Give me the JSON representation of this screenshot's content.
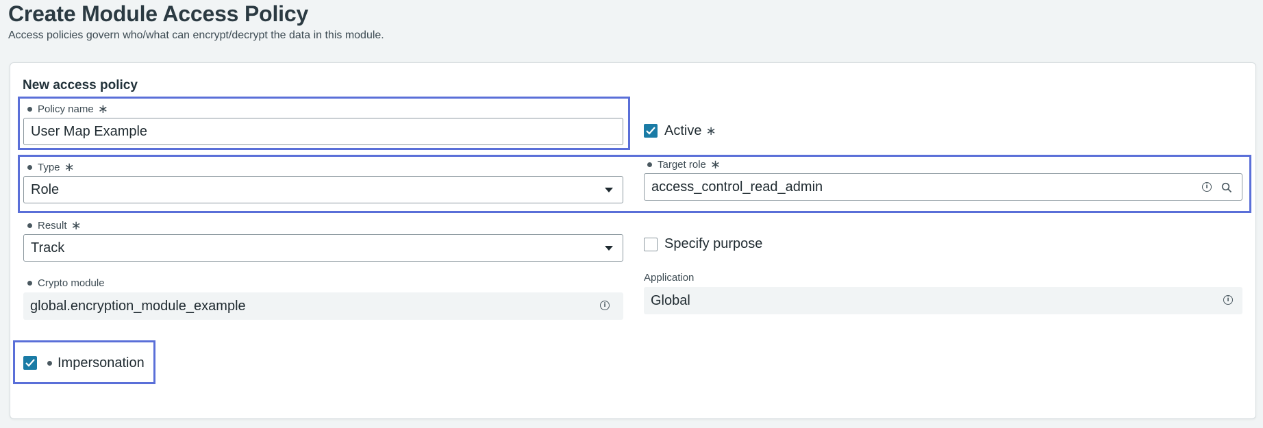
{
  "page": {
    "title": "Create Module Access Policy",
    "subtitle": "Access policies govern who/what can encrypt/decrypt the data in this module."
  },
  "form": {
    "section_title": "New access policy",
    "required_mark": "∗",
    "policy_name": {
      "label": "Policy name",
      "value": "User Map Example"
    },
    "active": {
      "label": "Active",
      "checked": true
    },
    "type": {
      "label": "Type",
      "value": "Role"
    },
    "target_role": {
      "label": "Target role",
      "value": "access_control_read_admin"
    },
    "result": {
      "label": "Result",
      "value": "Track"
    },
    "specify_purpose": {
      "label": "Specify purpose",
      "checked": false
    },
    "crypto_module": {
      "label": "Crypto module",
      "value": "global.encryption_module_example"
    },
    "application": {
      "label": "Application",
      "value": "Global"
    },
    "impersonation": {
      "label": "Impersonation",
      "checked": true
    }
  },
  "icons": {
    "info": "info-icon",
    "search": "search-icon",
    "dropdown": "chevron-down-icon",
    "check": "check-icon"
  },
  "colors": {
    "highlight": "#5a6fd8",
    "checkbox_checked": "#1a7ba5"
  }
}
